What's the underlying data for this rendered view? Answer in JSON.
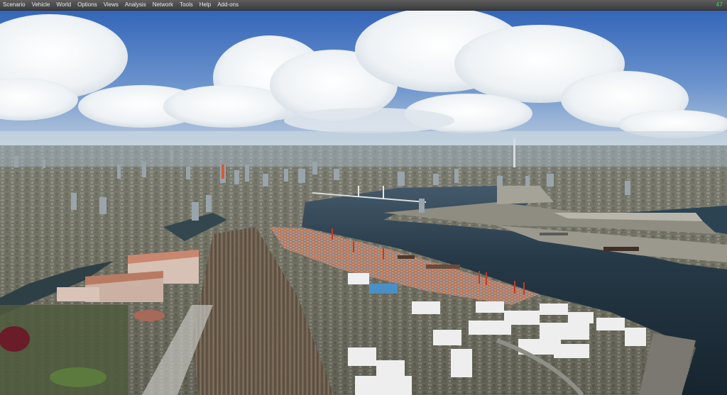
{
  "menubar": {
    "items": [
      {
        "label": "Scenario"
      },
      {
        "label": "Vehicle"
      },
      {
        "label": "World"
      },
      {
        "label": "Options"
      },
      {
        "label": "Views"
      },
      {
        "label": "Analysis"
      },
      {
        "label": "Network"
      },
      {
        "label": "Tools"
      },
      {
        "label": "Help"
      },
      {
        "label": "Add-ons"
      }
    ],
    "frame_rate": "47"
  },
  "scene": {
    "description": "Aerial flight-simulator view of a coastal city with port terminals, bay and bridge",
    "colors": {
      "sky_top": "#2f63b8",
      "sky_mid": "#6d95cf",
      "haze": "#b9c9d6",
      "water": "#1e2f3a",
      "city": "#7d7c72",
      "crane": "#c0392b"
    }
  }
}
